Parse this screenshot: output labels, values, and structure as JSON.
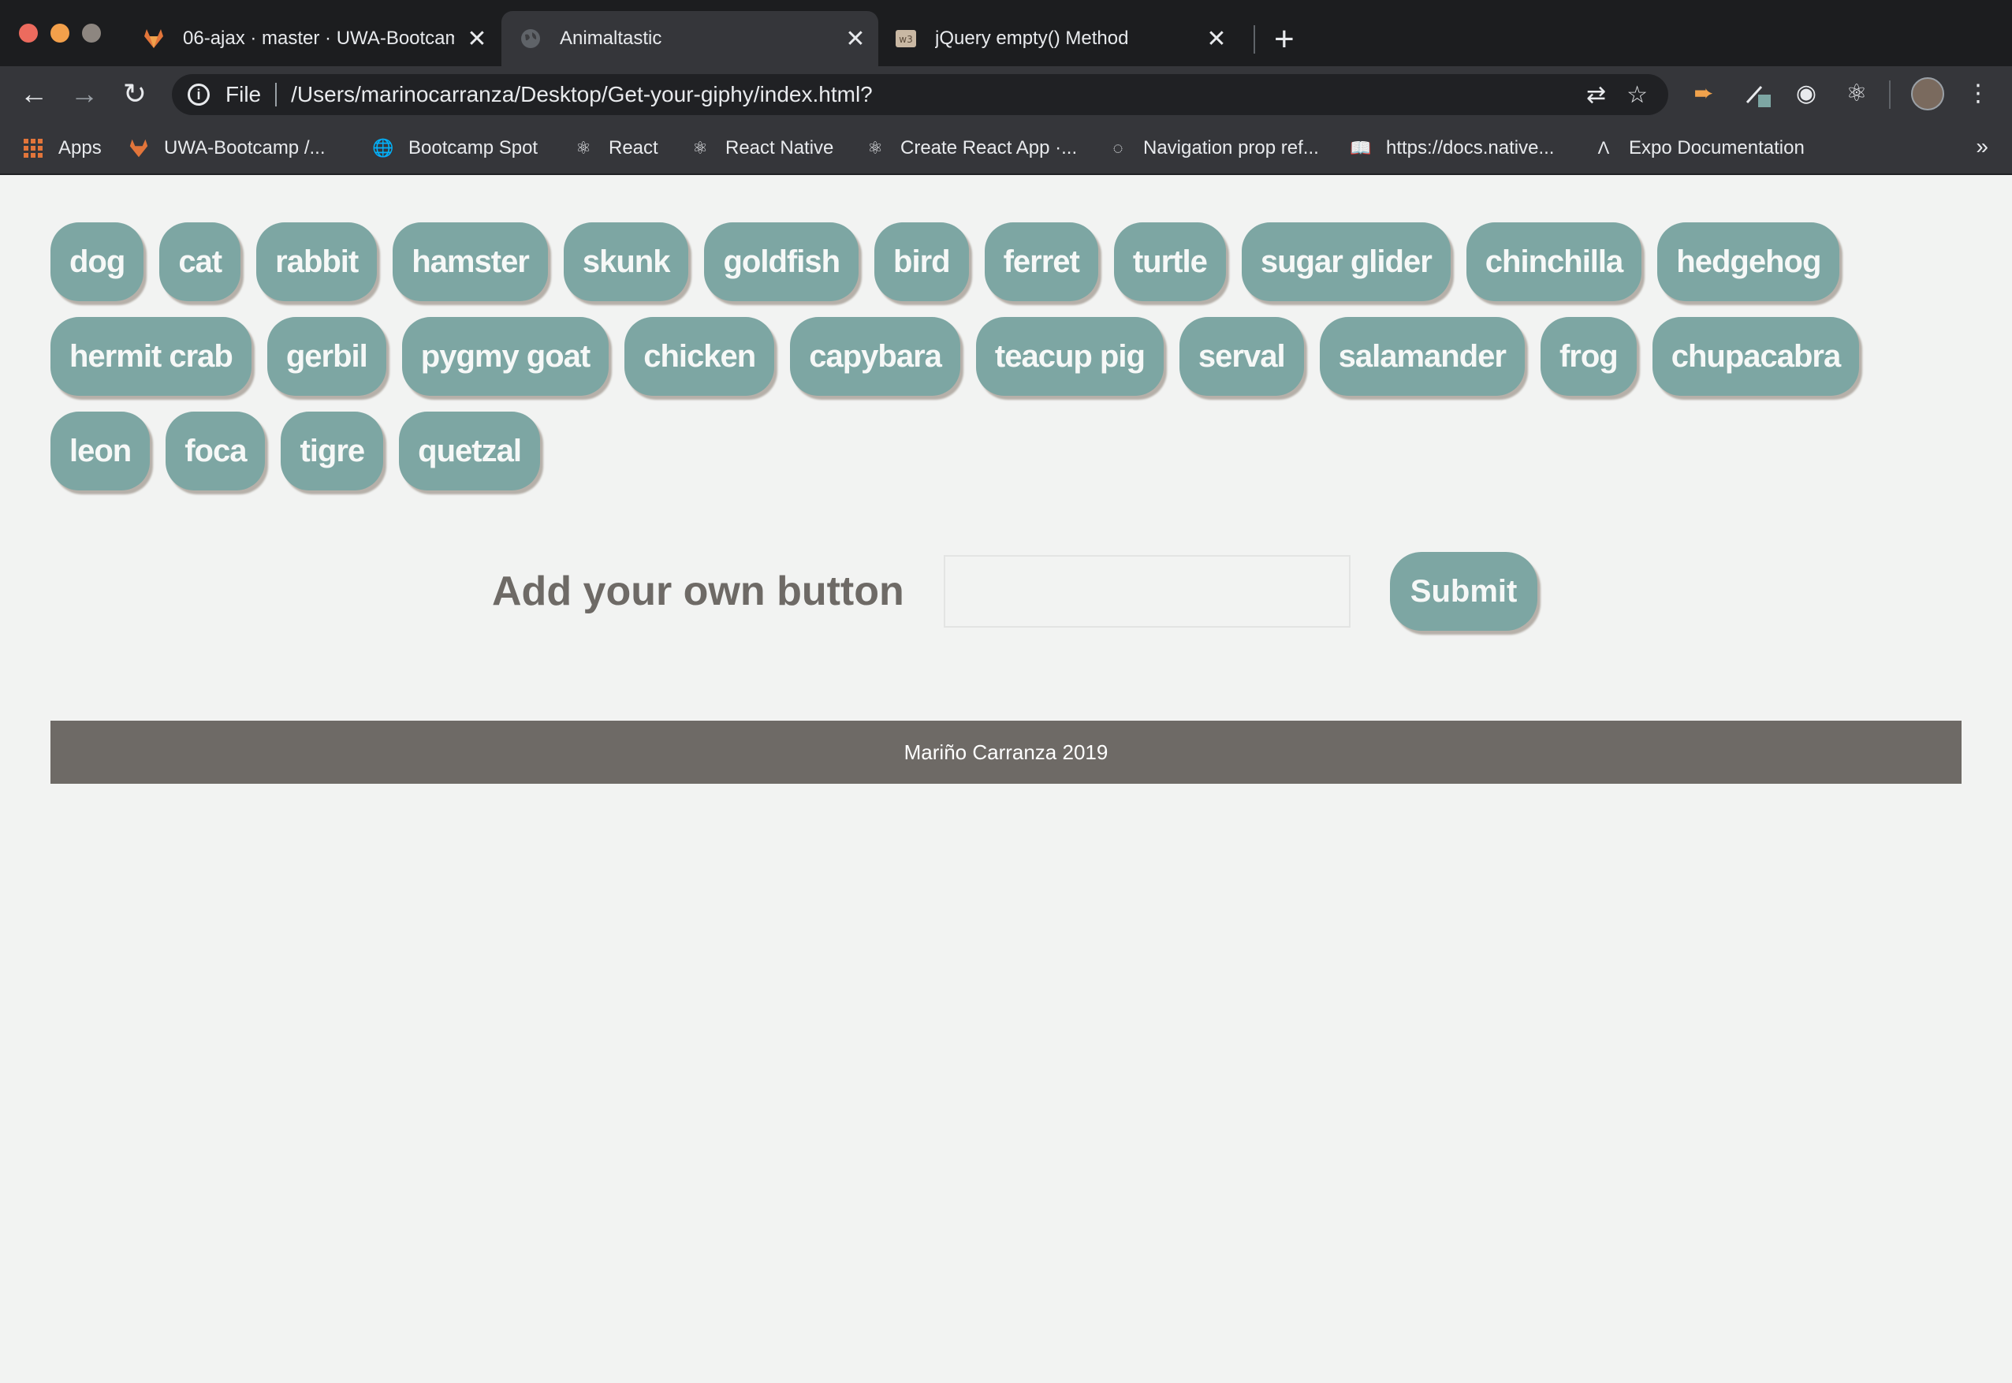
{
  "window": {
    "tabs": [
      {
        "title": "06-ajax · master · UWA-Bootcamp",
        "favicon": "gitlab-icon",
        "active": false
      },
      {
        "title": "Animaltastic",
        "favicon": "globe-icon",
        "active": true
      },
      {
        "title": "jQuery empty() Method",
        "favicon": "w3schools-icon",
        "active": false
      }
    ],
    "address": {
      "scheme": "File",
      "url": "/Users/marinocarranza/Desktop/Get-your-giphy/index.html?"
    },
    "bookmarks": [
      {
        "label": "Apps",
        "icon": "apps-grid-icon"
      },
      {
        "label": "UWA-Bootcamp /...",
        "icon": "gitlab-icon"
      },
      {
        "label": "Bootcamp Spot",
        "icon": "globe-icon"
      },
      {
        "label": "React",
        "icon": "react-icon"
      },
      {
        "label": "React Native",
        "icon": "react-icon"
      },
      {
        "label": "Create React App ·...",
        "icon": "react-icon"
      },
      {
        "label": "Navigation prop ref...",
        "icon": "circle-icon"
      },
      {
        "label": "https://docs.native...",
        "icon": "book-icon"
      },
      {
        "label": "Expo Documentation",
        "icon": "expo-icon"
      }
    ],
    "bookmarks_more": "»"
  },
  "page": {
    "animal_rows": [
      [
        "dog",
        "cat",
        "rabbit",
        "hamster",
        "skunk",
        "goldfish",
        "bird",
        "ferret",
        "turtle",
        "sugar glider",
        "chinchilla",
        "hedgehog"
      ],
      [
        "hermit crab",
        "gerbil",
        "pygmy goat",
        "chicken",
        "capybara",
        "teacup pig",
        "serval",
        "salamander",
        "frog",
        "chupacabra"
      ],
      [
        "leon",
        "foca",
        "tigre",
        "quetzal"
      ]
    ],
    "form": {
      "label": "Add your own button",
      "input_value": "",
      "submit_label": "Submit"
    },
    "footer_text": "Mariño Carranza 2019"
  },
  "colors": {
    "button_bg": "#7da6a3",
    "footer_bg": "#6e6a66",
    "page_bg": "#f2f3f2"
  }
}
